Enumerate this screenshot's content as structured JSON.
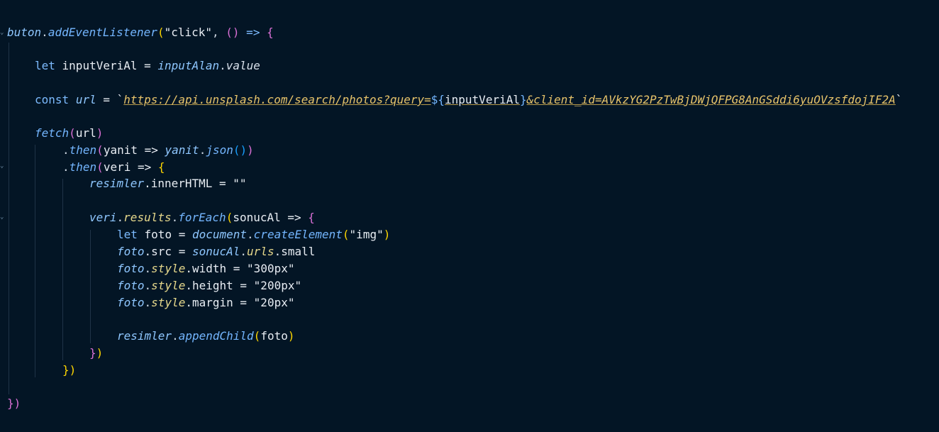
{
  "code": {
    "line1": {
      "a": "buton",
      "b": ".",
      "c": "addEventListener",
      "d": "(",
      "e": "\"click\"",
      "f": ", ",
      "g": "()",
      "h": " => ",
      "i": "{"
    },
    "line2": {
      "a": "let",
      "b": " inputVeriAl = ",
      "c": "inputAlan",
      "d": ".",
      "e": "value"
    },
    "line3": {
      "a": "const",
      "b": " ",
      "c": "url",
      "d": " = ",
      "e": "`",
      "f": "https://api.unsplash.com/search/photos?query=",
      "g": "${",
      "h": "inputVeriAl",
      "i": "}",
      "j": "&client_id=AVkzYG2PzTwBjDWjQFPG8AnGSddi6yuOVzsfdojIF2A",
      "k": "`"
    },
    "line4": {
      "a": "fetch",
      "b": "(",
      "c": "url",
      "d": ")"
    },
    "line5": {
      "a": ".",
      "b": "then",
      "c": "(",
      "d": "yanit => ",
      "e": "yanit",
      "f": ".",
      "g": "json",
      "h": "()",
      "i": ")"
    },
    "line6": {
      "a": ".",
      "b": "then",
      "c": "(",
      "d": "veri => ",
      "e": "{"
    },
    "line7": {
      "a": "resimler",
      "b": ".innerHTML = ",
      "c": "\"\""
    },
    "line8": {
      "a": "veri",
      "b": ".",
      "c": "results",
      "d": ".",
      "e": "forEach",
      "f": "(",
      "g": "sonucAl => ",
      "h": "{"
    },
    "line9": {
      "a": "let",
      "b": " foto = ",
      "c": "document",
      "d": ".",
      "e": "createElement",
      "f": "(",
      "g": "\"img\"",
      "h": ")"
    },
    "line10": {
      "a": "foto",
      "b": ".src = ",
      "c": "sonucAl",
      "d": ".",
      "e": "urls",
      "f": ".small"
    },
    "line11": {
      "a": "foto",
      "b": ".",
      "c": "style",
      "d": ".width = ",
      "e": "\"300px\""
    },
    "line12": {
      "a": "foto",
      "b": ".",
      "c": "style",
      "d": ".height = ",
      "e": "\"200px\""
    },
    "line13": {
      "a": "foto",
      "b": ".",
      "c": "style",
      "d": ".margin = ",
      "e": "\"20px\""
    },
    "line14": {
      "a": "resimler",
      "b": ".",
      "c": "appendChild",
      "d": "(",
      "e": "foto",
      "f": ")"
    },
    "line15": {
      "a": "}",
      "b": ")"
    },
    "line16": {
      "a": "})"
    },
    "line17": {
      "a": "})"
    }
  },
  "fold_icon": "chevron-down-icon",
  "colors": {
    "background": "#031525",
    "bracket_gold": "#ffd700",
    "bracket_pink": "#da70d6",
    "bracket_blue": "#179fff",
    "url_string": "#e7c36a"
  }
}
